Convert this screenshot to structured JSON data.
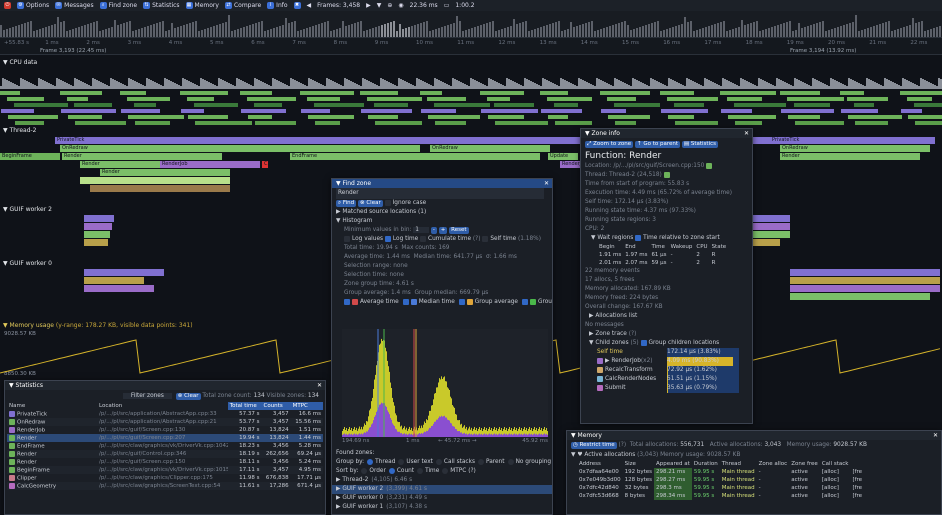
{
  "toolbar": {
    "items": [
      {
        "icon": "power-icon",
        "label": "",
        "color": "#d23a2e"
      },
      {
        "icon": "gear-icon",
        "label": "Options",
        "color": "#3b6fd8"
      },
      {
        "icon": "envelope-icon",
        "label": "Messages",
        "color": "#3b6fd8"
      },
      {
        "icon": "search-icon",
        "label": "Find zone",
        "color": "#3b6fd8"
      },
      {
        "icon": "sort-icon",
        "label": "Statistics",
        "color": "#3b6fd8"
      },
      {
        "icon": "memory-icon",
        "label": "Memory",
        "color": "#3b6fd8"
      },
      {
        "icon": "compare-icon",
        "label": "Compare",
        "color": "#3b6fd8"
      },
      {
        "icon": "info-icon",
        "label": "Info",
        "color": "#3b6fd8"
      },
      {
        "icon": "tools-icon",
        "label": "",
        "color": "#3b6fd8"
      }
    ],
    "frames": "Frames: 3,458",
    "view_time": "22.36 ms",
    "zoom": "1:00.2"
  },
  "ruler": {
    "ticks": [
      "+55.83 s",
      "1 ms",
      "2 ms",
      "3 ms",
      "4 ms",
      "5 ms",
      "6 ms",
      "7 ms",
      "8 ms",
      "9 ms",
      "10 ms",
      "11 ms",
      "12 ms",
      "13 ms",
      "14 ms",
      "15 ms",
      "16 ms",
      "17 ms",
      "18 ms",
      "19 ms",
      "20 ms",
      "21 ms",
      "22 ms"
    ],
    "frame_a": "Frame 3,193 (22.45 ms)",
    "frame_b": "Frame 3,194 (13.92 ms)"
  },
  "timeline": {
    "cpu_data": "CPU data",
    "thread2": "Thread-2",
    "worker2": "GUIF worker 2",
    "worker0": "GUIF worker 0",
    "memory_usage": "Memory usage",
    "memory_detail": "(y-range: 178.27 KB, visible data points: 341)",
    "mem_top": "9028.57 KB",
    "mem_bottom": "8850.30 KB",
    "zones": {
      "private": "PrivateTick",
      "onredraw": "OnRedraw",
      "begin": "BeginFrame",
      "render": "Render",
      "renderjob": "RenderJob",
      "endframe": "EndFrame",
      "update": "Update",
      "c": "C"
    }
  },
  "find_zone": {
    "title": "Find zone",
    "query": "Render",
    "find": "Find",
    "clear": "Clear",
    "ignore_case": "Ignore case",
    "matched": "Matched source locations (1)",
    "histogram": "Histogram",
    "min_values": "Minimum values in bin:",
    "min_value": "1",
    "reset": "Reset",
    "log_values": "Log values",
    "log_time": "Log time",
    "cumulate": "Cumulate time",
    "cumulate_q": "(?)",
    "self_time": "Self time",
    "self_pct": "(1.18%)",
    "total_time": "Total time: 19.94 s",
    "max_counts": "Max counts: 169",
    "average": "Average time: 1.44 ms",
    "median": "Median time: 641.77 µs",
    "sigma": "σ: 1.66 ms",
    "sel_range": "Selection range: none",
    "sel_time": "Selection time: none",
    "group_time": "Zone group time: 4.61 s",
    "group_avg": "Group average: 1.4 ms",
    "group_median": "Group median: 669.79 µs",
    "legend": [
      "Average time",
      "Median time",
      "Group average",
      "Group median"
    ],
    "axis_left": "194.69 ns",
    "axis_mid": "1 ms",
    "axis_range": "← 45.72 ms →",
    "axis_right": "45.92 ms",
    "found_zones": "Found zones:",
    "group_by": "Group by:",
    "group_opts": [
      "Thread",
      "User text",
      "Call stacks",
      "Parent",
      "No grouping"
    ],
    "sort_by": "Sort by:",
    "sort_opts": [
      "Order",
      "Count",
      "Time",
      "MTPC (?)"
    ],
    "groups": [
      {
        "label": "Thread-2",
        "detail": "(4,105) 6.46 s"
      },
      {
        "label": "GUIF worker 2",
        "detail": "(3,399) 4.61 s"
      },
      {
        "label": "GUIF worker 0",
        "detail": "(3,231) 4.49 s"
      },
      {
        "label": "GUIF worker 1",
        "detail": "(3,107) 4.38 s"
      }
    ]
  },
  "zone_info": {
    "title": "Zone info",
    "zoom_btn": "Zoom to zone",
    "parent_btn": "Go to parent",
    "stats_btn": "Statistics",
    "function": "Function: Render",
    "location": "Location: /p/.../pl/src/guif/Screen.cpp:150",
    "thread": "Thread: Thread-2",
    "thread_id": "(24,518)",
    "lines": [
      "Time from start of program: 55.83 s",
      "Execution time: 4.49 ms (65.72% of average time)",
      "Self time: 172.14 µs (3.83%)",
      "Running state time: 4.37 ms (97.33%)",
      "Running state regions: 3",
      "CPU: 2"
    ],
    "wait_regions": "Wait regions",
    "relative": "Time relative to zone start",
    "wait_headers": [
      "Begin",
      "End",
      "Time",
      "Wakeup",
      "CPU",
      "State"
    ],
    "wait_rows": [
      [
        "1.91 ms",
        "1.97 ms",
        "61 µs",
        "-",
        "2",
        "R"
      ],
      [
        "2.01 ms",
        "2.07 ms",
        "59 µs",
        "-",
        "2",
        "R"
      ]
    ],
    "mem_lines": [
      "22 memory events",
      "17 allocs, 5 frees",
      "Memory allocated: 167.89 KB",
      "Memory freed: 224 bytes",
      "Overall change: 167.67 KB"
    ],
    "alloc_list": "Allocations list",
    "messages": "No messages",
    "zone_trace": "Zone trace",
    "zone_trace_q": "(?)",
    "child_zones": "Child zones",
    "child_count": "(5)",
    "group_children": "Group children locations",
    "self_label": "Self time",
    "self_value": "172.14 µs (3.83%)",
    "children": [
      {
        "name": "RenderJob",
        "count": "(x2)",
        "value": "4.09 ms (90.83%)",
        "color": "#9a6cc8",
        "fill": 0.91
      },
      {
        "name": "RecalcTransform",
        "count": "",
        "value": "72.92 µs (1.62%)",
        "color": "#d0a86a",
        "fill": 0.02
      },
      {
        "name": "CalcRenderNodes",
        "count": "",
        "value": "51.51 µs (1.15%)",
        "color": "#7ab6d6",
        "fill": 0.01
      },
      {
        "name": "Submit",
        "count": "",
        "value": "35.63 µs (0.79%)",
        "color": "#b66cbf",
        "fill": 0.01
      }
    ]
  },
  "statistics": {
    "title": "Statistics",
    "filter": "Filter zones",
    "clear": "Clear",
    "total": "Total zone count:",
    "total_val": "134",
    "visible": "Visible zones:",
    "visible_val": "134",
    "headers": [
      "Name",
      "Location",
      "Total time",
      "Counts",
      "MTPC"
    ],
    "rows": [
      {
        "name": "PrivateTick",
        "loc": "/p/.../pl/src/application/AbstractApp.cpp:33",
        "total": "57.37 s",
        "count": "3,457",
        "mtpc": "16.6 ms",
        "color": "#8070d0"
      },
      {
        "name": "OnRedraw",
        "loc": "/p/.../pl/src/application/AbstractApp.cpp:21",
        "total": "53.77 s",
        "count": "3,457",
        "mtpc": "15.56 ms",
        "color": "#6db35a"
      },
      {
        "name": "RenderJob",
        "loc": "/p/.../pl/src/guif/Screen.cpp:130",
        "total": "20.87 s",
        "count": "13,824",
        "mtpc": "1.51 ms",
        "color": "#9a6cc8"
      },
      {
        "name": "Render",
        "loc": "/p/.../pl/src/guif/Screen.cpp:207",
        "total": "19.94 s",
        "count": "13,824",
        "mtpc": "1.44 ms",
        "color": "#6db35a"
      },
      {
        "name": "EndFrame",
        "loc": "/p/.../pl/src/claw/graphics/vk/DriverVk.cpp:1042",
        "total": "18.23 s",
        "count": "3,456",
        "mtpc": "5.28 ms",
        "color": "#6db35a"
      },
      {
        "name": "Render",
        "loc": "/p/.../pl/src/guif/Control.cpp:346",
        "total": "18.19 s",
        "count": "262,656",
        "mtpc": "69.24 µs",
        "color": "#6db35a"
      },
      {
        "name": "Render",
        "loc": "/p/.../pl/src/guif/Screen.cpp:150",
        "total": "18.11 s",
        "count": "3,456",
        "mtpc": "5.24 ms",
        "color": "#6db35a"
      },
      {
        "name": "BeginFrame",
        "loc": "/p/.../pl/src/claw/graphics/vk/DriverVk.cpp:1015",
        "total": "17.11 s",
        "count": "3,457",
        "mtpc": "4.95 ms",
        "color": "#6db35a"
      },
      {
        "name": "Clipper",
        "loc": "/p/.../pl/src/claw/graphics/Clipper.cpp:175",
        "total": "11.98 s",
        "count": "676,838",
        "mtpc": "17.71 µs",
        "color": "#c87a8a"
      },
      {
        "name": "CalcGeometry",
        "loc": "/p/.../pl/src/claw/graphics/ScreenText.cpp:54",
        "total": "11.61 s",
        "count": "17,286",
        "mtpc": "671.4 µs",
        "color": "#b66cbf"
      }
    ]
  },
  "memory": {
    "title": "Memory",
    "restrict": "Restrict time",
    "restrict_q": "(?)",
    "total_allocs": "Total allocations:",
    "total_allocs_val": "556,731",
    "active_allocs": "Active allocations:",
    "active_allocs_val": "3,043",
    "usage": "Memory usage:",
    "usage_val": "9028.57 KB",
    "section": "Active allocations",
    "section_count": "(3,043)",
    "section_usage": "Memory usage: 9028.57 KB",
    "headers": [
      "Address",
      "Size",
      "Appeared at",
      "Duration",
      "Thread",
      "Zone alloc",
      "Zone free",
      "Call stack"
    ],
    "rows": [
      [
        "0x7dfaa64e00",
        "192 bytes",
        "298.21 ms",
        "59.95 s",
        "Main thread",
        "-",
        "active",
        "[alloc]",
        "[fre"
      ],
      [
        "0x7e049b3d00",
        "128 bytes",
        "298.27 ms",
        "59.95 s",
        "Main thread",
        "-",
        "active",
        "[alloc]",
        "[fre"
      ],
      [
        "0x7dfc42d840",
        "32 bytes",
        "298.3 ms",
        "59.95 s",
        "Main thread",
        "-",
        "active",
        "[alloc]",
        "[fre"
      ],
      [
        "0x7dfc53d668",
        "8 bytes",
        "298.34 ms",
        "59.95 s",
        "Main thread",
        "-",
        "active",
        "[alloc]",
        "[fre"
      ]
    ]
  }
}
